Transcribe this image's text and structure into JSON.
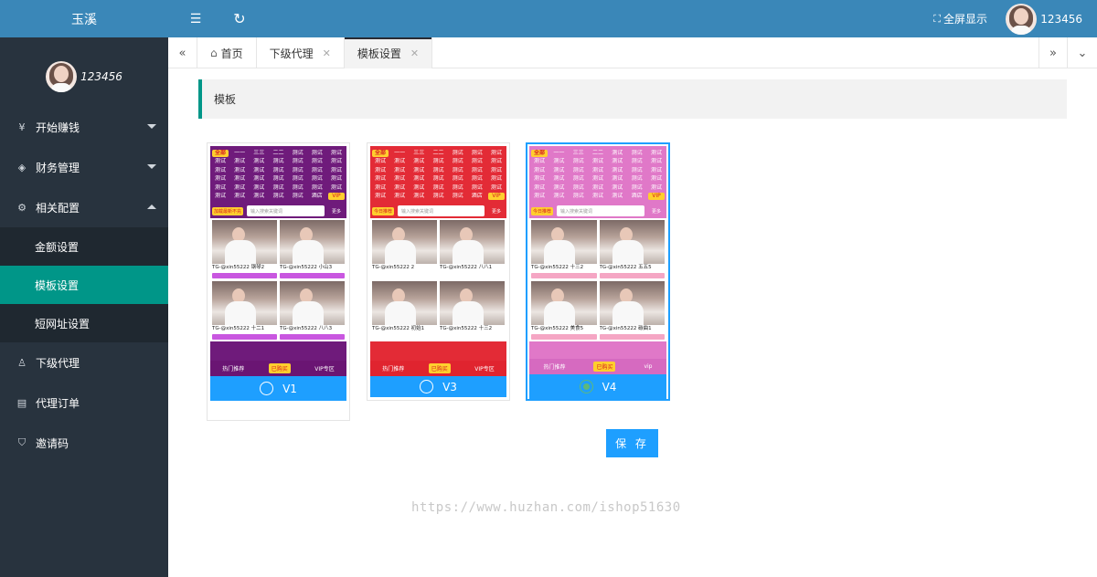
{
  "sidebar": {
    "logo": "玉溪",
    "user_name": "123456",
    "menu": [
      {
        "label": "开始赚钱",
        "icon": "¥"
      },
      {
        "label": "财务管理",
        "icon": "◈"
      },
      {
        "label": "相关配置",
        "icon": "⚙"
      }
    ],
    "submenu": [
      "金额设置",
      "模板设置",
      "短网址设置"
    ],
    "menu2": [
      {
        "label": "下级代理",
        "icon": "♙"
      },
      {
        "label": "代理订单",
        "icon": "▤"
      },
      {
        "label": "邀请码",
        "icon": "⛉"
      }
    ]
  },
  "header": {
    "fullscreen": "全屏显示",
    "user_name": "123456",
    "fold_icon": "☰",
    "refresh_icon": "↻"
  },
  "tabs": {
    "home": "首页",
    "agents": "下级代理",
    "template": "模板设置"
  },
  "panel_title": "模板",
  "templates": [
    {
      "name": "V1",
      "theme": "#6f1b7b",
      "grid": "#ffffff",
      "selected": false
    },
    {
      "name": "V3",
      "theme": "#e32b36",
      "grid": "#ffffff",
      "selected": false
    },
    {
      "name": "V4",
      "theme": "#e078c8",
      "grid": "#ffffff",
      "selected": true
    }
  ],
  "preview": {
    "cat_first": "全部",
    "cat_row1": [
      "一一",
      "三三",
      "二二",
      "测试",
      "测试",
      "测试"
    ],
    "cat_word": "测试",
    "cat_last": "酒店",
    "vip": "VIP",
    "search_placeholder": "输入搜索关键词",
    "more": "更多",
    "hot_btn_v1": "加载最新不充",
    "hot_btn": "今日推荐",
    "card_titles_v1": [
      "TG-@xin55222 钢琴2",
      "TG-@xin55222 小山3",
      "TG-@xin55222 十二1",
      "TG-@xin55222 八八3"
    ],
    "card_titles_v3": [
      "TG-@xin55222 2",
      "TG-@xin55222 八八1",
      "TG-@xin55222 初始1",
      "TG-@xin55222 十三2"
    ],
    "card_titles_v4": [
      "TG-@xin55222 十三2",
      "TG-@xin55222 五五5",
      "TG-@xin55222 美食5",
      "TG-@xin55222 碳曲1"
    ],
    "bottom_left": "热门推荐",
    "bottom_mid": "已购买",
    "bottom_right_v1": "VIP专区",
    "bottom_right_v3": "VIP专区",
    "bottom_right_v4": "vip"
  },
  "save_label": "保 存",
  "watermark": "https://www.huzhan.com/ishop51630",
  "colors": {
    "accent": "#1e9fff",
    "active_menu": "#009688",
    "header": "#3a87b8",
    "sidebar": "#28333e"
  }
}
